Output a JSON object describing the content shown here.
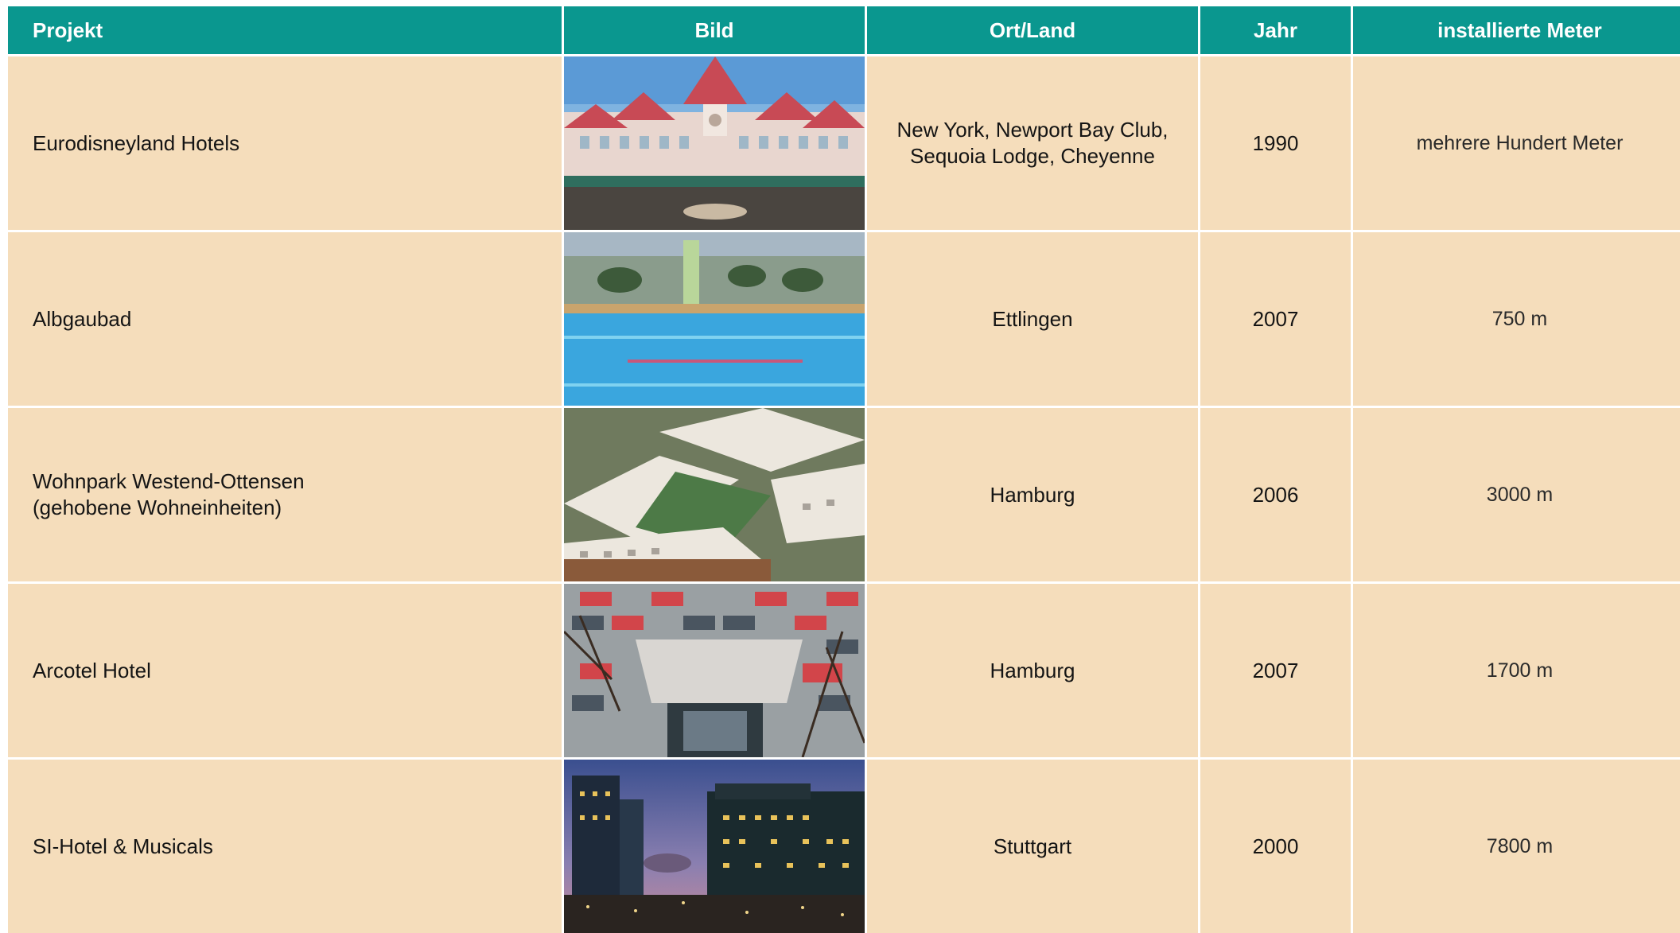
{
  "table": {
    "headers": [
      "Projekt",
      "Bild",
      "Ort/Land",
      "Jahr",
      "installierte Meter"
    ],
    "rows": [
      {
        "project": "Eurodisneyland Hotels",
        "image": "photo-disneyland-hotel",
        "location": "New York, Newport Bay Club,\nSequoia Lodge, Cheyenne",
        "year": "1990",
        "meters": "mehrere Hundert Meter"
      },
      {
        "project": "Albgaubad",
        "image": "photo-swimming-pool",
        "location": "Ettlingen",
        "year": "2007",
        "meters": "750 m"
      },
      {
        "project": "Wohnpark Westend-Ottensen\n(gehobene Wohneinheiten)",
        "image": "photo-residential-complex",
        "location": "Hamburg",
        "year": "2006",
        "meters": "3000 m"
      },
      {
        "project": "Arcotel Hotel",
        "image": "photo-hotel-facade",
        "location": "Hamburg",
        "year": "2007",
        "meters": "1700 m"
      },
      {
        "project": "SI-Hotel & Musicals",
        "image": "photo-city-night-skyline",
        "location": "Stuttgart",
        "year": "2000",
        "meters": "7800 m"
      }
    ]
  },
  "colors": {
    "header_bg": "#0a978f",
    "row_bg": "#f5ddbb",
    "header_text": "#ffffff"
  }
}
